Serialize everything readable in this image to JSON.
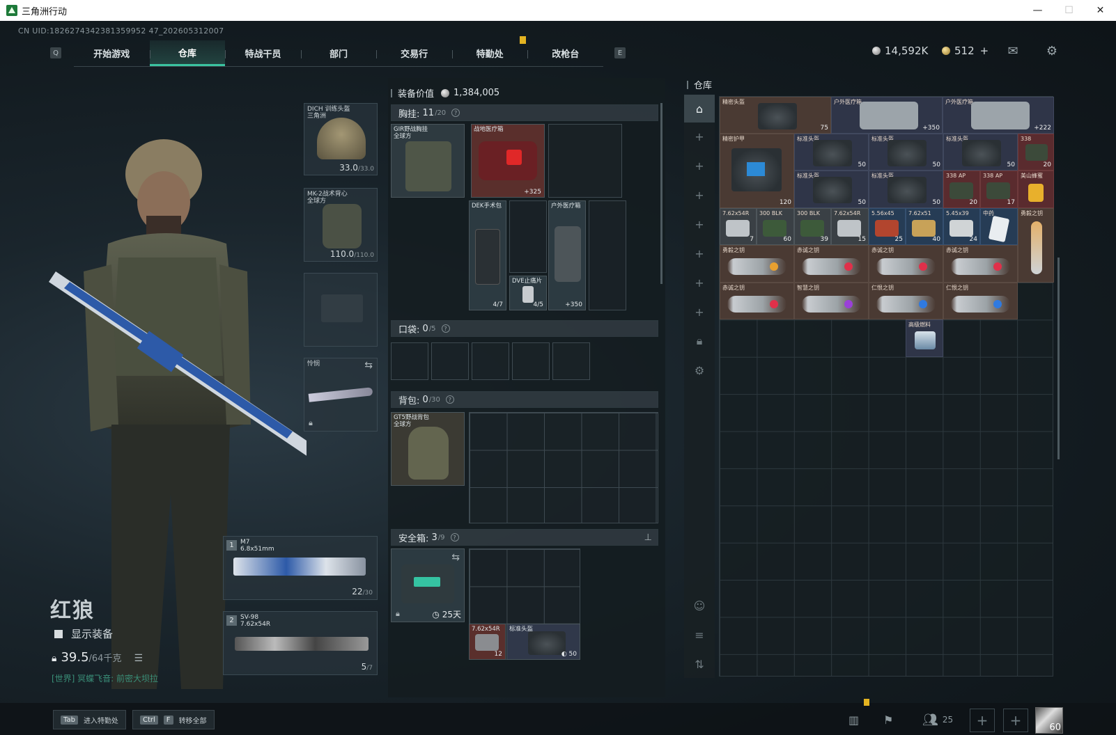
{
  "window": {
    "title": "三角洲行动"
  },
  "uid": "CN UID:1826274342381359952 47_202605312007",
  "nav": {
    "tabs": [
      "开始游戏",
      "仓库",
      "特战干员",
      "部门",
      "交易行",
      "特勤处",
      "改枪台"
    ],
    "active": 1,
    "left_key": "Q",
    "right_key": "E"
  },
  "currency": {
    "coins": "14,592K",
    "gold": "512",
    "gold_plus": "+"
  },
  "operator": {
    "name": "红狼",
    "show_equipment": "显示装备",
    "weight": "39.5",
    "weight_max": "/64千克",
    "world_msg": "[世界] 冥蝶飞音: 前密大坝拉"
  },
  "gear": {
    "helmet": {
      "label1": "DICH 训练头盔",
      "label2": "三角洲",
      "value": "33.0",
      "max": "/33.0"
    },
    "armor": {
      "label1": "MK-2战术背心",
      "label2": "全球方",
      "value": "110.0",
      "max": "/110.0"
    },
    "melee": {
      "label": "怜悯"
    }
  },
  "weapons": [
    {
      "num": "1",
      "name": "M7",
      "caliber": "6.8x51mm",
      "ammo": "22",
      "ammo_max": "/30"
    },
    {
      "num": "2",
      "name": "SV-98",
      "caliber": "7.62x54R",
      "ammo": "5",
      "ammo_max": "/7"
    }
  ],
  "loadout": {
    "value_label": "装备价值",
    "value": "1,384,005",
    "chest": {
      "label": "胸挂:",
      "count": "11",
      "max": "/20"
    },
    "chest_item": {
      "name1": "GIR野战胸挂",
      "name2": "全球方"
    },
    "pockets": {
      "label": "口袋:",
      "count": "0",
      "max": "/5"
    },
    "backpack": {
      "label": "背包:",
      "count": "0",
      "max": "/30"
    },
    "backpack_item": {
      "name1": "GT5野战背包",
      "name2": "全球方"
    },
    "safebox": {
      "label": "安全箱:",
      "count": "3",
      "max": "/9",
      "days": "25天"
    },
    "items": [
      {
        "name": "战地医疗箱",
        "value": "+325"
      },
      {
        "name": "DEK手术包",
        "value": "4/7"
      },
      {
        "name": "DVE止痛片",
        "value": "4/5"
      },
      {
        "name": "户外医疗箱",
        "value": "+350"
      }
    ],
    "safe_items": [
      {
        "name": "7.62x54R",
        "value": "12"
      },
      {
        "name": "标准头盔",
        "value": "50"
      }
    ]
  },
  "warehouse": {
    "title": "仓库",
    "items": [
      {
        "name": "精密头盔",
        "value": "75"
      },
      {
        "name": "户外医疗箱",
        "value": "+350"
      },
      {
        "name": "户外医疗箱",
        "value": "+222"
      },
      {
        "name": "精密护甲",
        "value": "120"
      },
      {
        "name": "标准头盔",
        "value": "50"
      },
      {
        "name": "标准头盔",
        "value": "50"
      },
      {
        "name": "标准头盔",
        "value": "50"
      },
      {
        "name": "338",
        "value": "20"
      },
      {
        "name": "标准头盔",
        "value": "50"
      },
      {
        "name": "标准头盔",
        "value": "50"
      },
      {
        "name": "338 AP",
        "value": "20"
      },
      {
        "name": "338 AP",
        "value": "17"
      },
      {
        "name": "美山蜂蜜",
        "value": ""
      },
      {
        "name": "7.62x54R",
        "value": "7"
      },
      {
        "name": "300 BLK",
        "value": "60"
      },
      {
        "name": "300 BLK",
        "value": "39"
      },
      {
        "name": "7.62x54R",
        "value": "15"
      },
      {
        "name": "5.56x45",
        "value": "25"
      },
      {
        "name": "7.62x51",
        "value": "40"
      },
      {
        "name": "5.45x39",
        "value": "24"
      },
      {
        "name": "中药",
        "value": ""
      },
      {
        "name": "勇毅之钥",
        "value": ""
      },
      {
        "name": "勇毅之钥",
        "value": ""
      },
      {
        "name": "赤诚之钥",
        "value": ""
      },
      {
        "name": "赤诚之钥",
        "value": ""
      },
      {
        "name": "赤诚之钥",
        "value": ""
      },
      {
        "name": "赤诚之钥",
        "value": ""
      },
      {
        "name": "智慧之钥",
        "value": ""
      },
      {
        "name": "仁恨之钥",
        "value": ""
      },
      {
        "name": "仁恨之钥",
        "value": ""
      },
      {
        "name": "高级燃料",
        "value": ""
      }
    ]
  },
  "bottom": {
    "tab_key": "Tab",
    "tab_label": "进入特勤处",
    "ctrl_key": "Ctrl",
    "f_key": "F",
    "ctrl_label": "转移全部",
    "friends": "25",
    "level": "60"
  }
}
